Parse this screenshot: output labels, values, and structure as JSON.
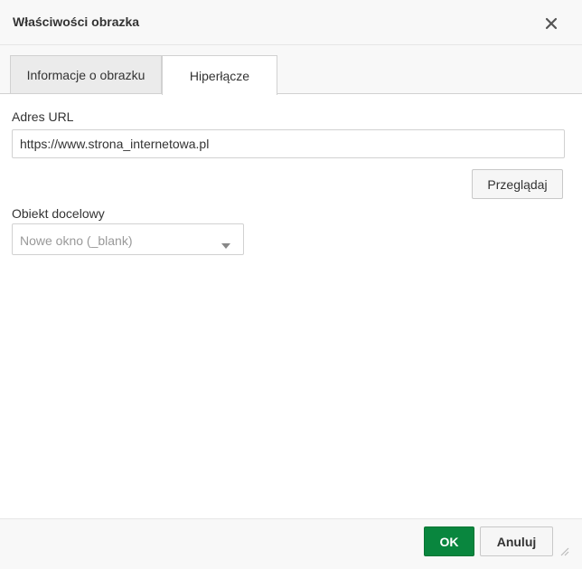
{
  "dialog": {
    "title": "Właściwości obrazka",
    "close_icon": "close-icon"
  },
  "tabs": [
    {
      "label": "Informacje o obrazku",
      "active": false
    },
    {
      "label": "Hiperłącze",
      "active": true
    }
  ],
  "link": {
    "url_label": "Adres URL",
    "url_value": "https://www.strona_internetowa.pl",
    "browse_label": "Przeglądaj",
    "target_label": "Obiekt docelowy",
    "target_value": "Nowe okno (_blank)",
    "dropdown_icon": "chevron-down-icon"
  },
  "footer": {
    "ok_label": "OK",
    "cancel_label": "Anuluj",
    "resize_icon": "resize-handle-icon"
  },
  "colors": {
    "ok_button": "#09863e",
    "background_bars": "#f8f8f8",
    "placeholder_text": "#999999"
  }
}
